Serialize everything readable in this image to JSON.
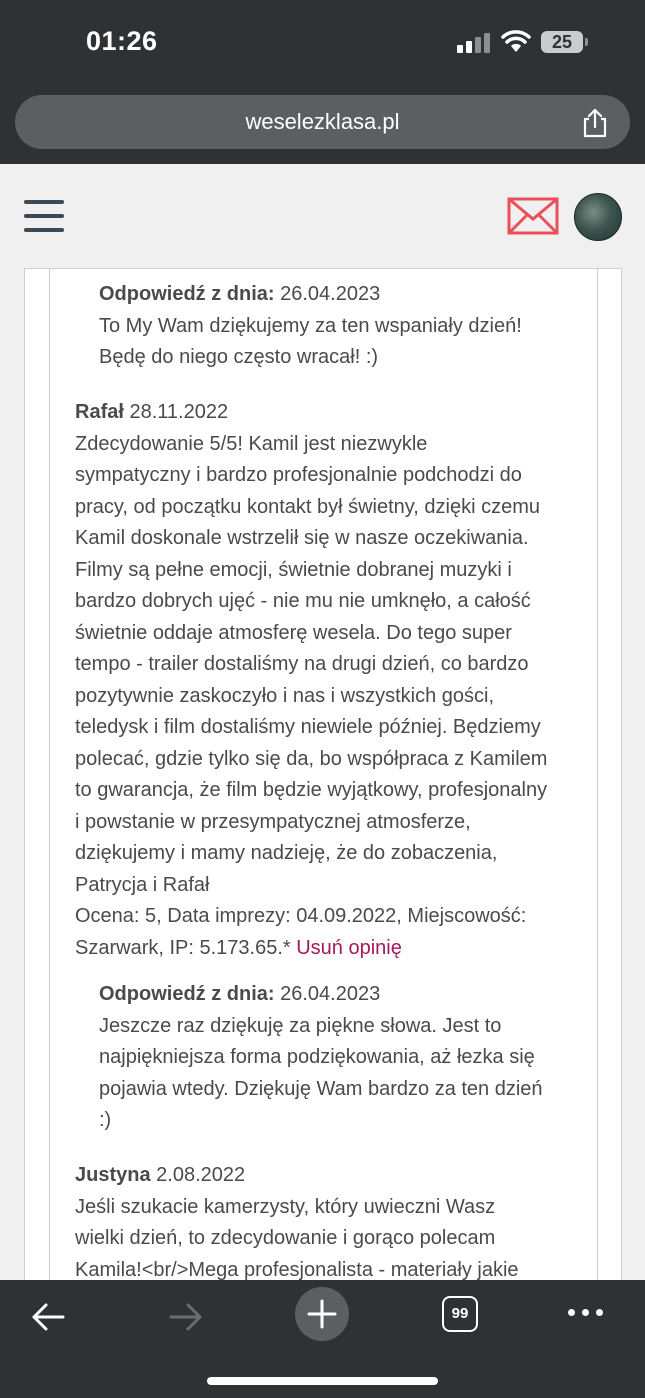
{
  "status_bar": {
    "time": "01:26",
    "battery": "25"
  },
  "browser": {
    "url": "weselezklasa.pl",
    "tabs_count": "99"
  },
  "icons": {
    "menu": "hamburger-icon",
    "mail": "mail-icon",
    "share": "share-icon",
    "back": "back-arrow-icon",
    "forward": "forward-arrow-icon",
    "new_tab": "plus-icon",
    "more": "more-icon"
  },
  "colors": {
    "link": "#a3195b",
    "mail_icon": "#e8505b",
    "chrome_bg": "#2e3235"
  },
  "reviews": {
    "reply1": {
      "label": "Odpowiedź z dnia:",
      "date": " 26.04.2023",
      "lines": [
        "To My Wam dziękujemy za ten wspaniały dzień!",
        "Będę do niego często wracał! :)"
      ]
    },
    "review1": {
      "author": "Rafał",
      "date": " 28.11.2022",
      "lines": [
        "Zdecydowanie 5/5! Kamil jest niezwykle",
        "sympatyczny i bardzo profesjonalnie podchodzi do",
        "pracy, od początku kontakt był świetny, dzięki czemu",
        "Kamil doskonale wstrzelił się w nasze oczekiwania.",
        "Filmy są pełne emocji, świetnie dobranej muzyki i",
        "bardzo dobrych ujęć - nie mu nie umknęło, a całość",
        "świetnie oddaje atmosferę wesela. Do tego super",
        "tempo - trailer dostaliśmy na drugi dzień, co bardzo",
        "pozytywnie zaskoczyło i nas i wszystkich gości,",
        "teledysk i film dostaliśmy niewiele później. Będziemy",
        "polecać, gdzie tylko się da, bo współpraca z Kamilem",
        "to gwarancja, że film będzie wyjątkowy, profesjonalny",
        "i powstanie w przesympatycznej atmosferze,",
        "dziękujemy i mamy nadzieję, że do zobaczenia,",
        "Patrycja i Rafał",
        "Ocena: 5, Data imprezy: 04.09.2022, Miejscowość:"
      ],
      "meta_tail": "Szarwark, IP: 5.173.65.* ",
      "delete_link": "Usuń opinię"
    },
    "reply2": {
      "label": "Odpowiedź z dnia:",
      "date": " 26.04.2023",
      "lines": [
        "Jeszcze raz dziękuję za piękne słowa. Jest to",
        "najpiękniejsza forma podziękowania, aż łezka się",
        "pojawia wtedy. Dziękuję Wam bardzo za ten dzień",
        ":)"
      ]
    },
    "review2": {
      "author": "Justyna",
      "date": " 2.08.2022",
      "lines": [
        "Jeśli szukacie kamerzysty, który uwieczni Wasz",
        "wielki dzień, to zdecydowanie i gorąco polecam",
        "Kamila!<br/>Mega profesjonalista - materiały jakie"
      ]
    }
  }
}
